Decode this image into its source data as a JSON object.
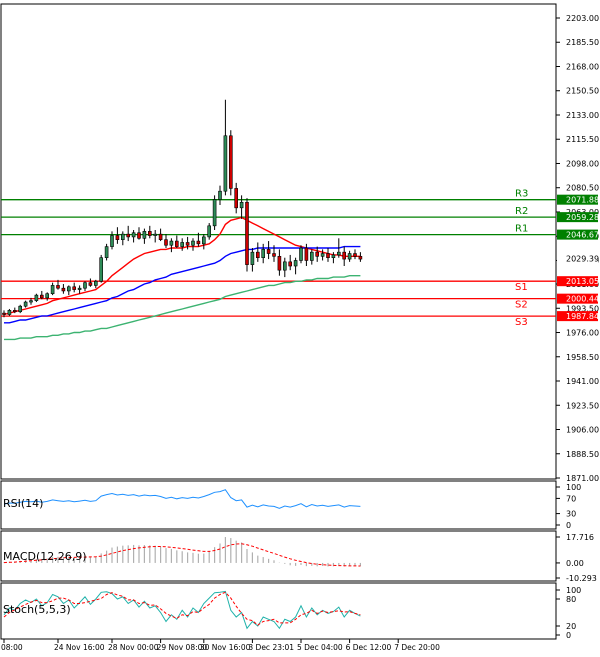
{
  "chart_data": {
    "type": "candlestick",
    "instrument_note": "",
    "price_axis": {
      "ticks": [
        "2203.00",
        "2185.50",
        "2168.00",
        "2150.50",
        "2133.00",
        "2115.50",
        "2098.00",
        "2080.50",
        "2063.00",
        "2045.50",
        "2028.00",
        "2011.00",
        "1993.50",
        "1976.00",
        "1958.50",
        "1941.00",
        "1923.50",
        "1906.00",
        "1888.50",
        "1871.00"
      ],
      "ylim": [
        1871.0,
        2203.0
      ],
      "current_price": "2029.39",
      "current_value": 2029.39
    },
    "time_axis": {
      "ticks": [
        "08:00",
        "24 Nov 16:00",
        "28 Nov 00:00",
        "29 Nov 08:00",
        "30 Nov 16:00",
        "3 Dec 23:01",
        "5 Dec 04:00",
        "6 Dec 12:00",
        "7 Dec 20:00"
      ],
      "tick_index": [
        0,
        10,
        20,
        29,
        37,
        46,
        55,
        64,
        73
      ]
    },
    "levels": [
      {
        "name": "R3",
        "label": "2071.88",
        "value": 2071.88,
        "color": "#008000"
      },
      {
        "name": "R2",
        "label": "2059.28",
        "value": 2059.28,
        "color": "#008000"
      },
      {
        "name": "R1",
        "label": "2046.67",
        "value": 2046.67,
        "color": "#008000"
      },
      {
        "name": "S1",
        "label": "2013.05",
        "value": 2013.05,
        "color": "#ff0000"
      },
      {
        "name": "S2",
        "label": "2000.44",
        "value": 2000.44,
        "color": "#ff0000"
      },
      {
        "name": "S3",
        "label": "1987.84",
        "value": 1987.84,
        "color": "#ff0000"
      }
    ],
    "candles": [
      [
        1990,
        1992,
        1987,
        1989
      ],
      [
        1989,
        1993,
        1988,
        1992
      ],
      [
        1992,
        1994,
        1990,
        1991
      ],
      [
        1991,
        1996,
        1990,
        1995
      ],
      [
        1995,
        1999,
        1994,
        1998
      ],
      [
        1998,
        2001,
        1996,
        1999
      ],
      [
        1999,
        2004,
        1998,
        2003
      ],
      [
        2003,
        2006,
        2000,
        2001
      ],
      [
        2001,
        2005,
        1999,
        2004
      ],
      [
        2004,
        2012,
        2003,
        2010
      ],
      [
        2010,
        2014,
        2007,
        2008
      ],
      [
        2008,
        2011,
        2004,
        2006
      ],
      [
        2006,
        2010,
        2003,
        2009
      ],
      [
        2009,
        2012,
        2005,
        2007
      ],
      [
        2007,
        2010,
        2004,
        2008
      ],
      [
        2008,
        2013,
        2006,
        2012
      ],
      [
        2012,
        2015,
        2009,
        2010
      ],
      [
        2010,
        2014,
        2008,
        2013
      ],
      [
        2013,
        2032,
        2012,
        2030
      ],
      [
        2030,
        2040,
        2028,
        2038
      ],
      [
        2038,
        2049,
        2036,
        2046
      ],
      [
        2046,
        2052,
        2040,
        2043
      ],
      [
        2043,
        2049,
        2039,
        2047
      ],
      [
        2047,
        2053,
        2042,
        2045
      ],
      [
        2045,
        2050,
        2041,
        2048
      ],
      [
        2048,
        2052,
        2043,
        2044
      ],
      [
        2044,
        2051,
        2040,
        2049
      ],
      [
        2049,
        2053,
        2044,
        2046
      ],
      [
        2046,
        2050,
        2041,
        2047
      ],
      [
        2047,
        2051,
        2042,
        2043
      ],
      [
        2043,
        2047,
        2037,
        2039
      ],
      [
        2039,
        2044,
        2034,
        2042
      ],
      [
        2042,
        2046,
        2037,
        2038
      ],
      [
        2038,
        2044,
        2035,
        2041
      ],
      [
        2041,
        2045,
        2036,
        2039
      ],
      [
        2039,
        2044,
        2035,
        2042
      ],
      [
        2042,
        2048,
        2038,
        2040
      ],
      [
        2040,
        2047,
        2036,
        2045
      ],
      [
        2045,
        2055,
        2043,
        2053
      ],
      [
        2053,
        2075,
        2050,
        2072
      ],
      [
        2072,
        2082,
        2068,
        2078
      ],
      [
        2078,
        2144,
        2075,
        2118
      ],
      [
        2118,
        2122,
        2075,
        2080
      ],
      [
        2080,
        2084,
        2062,
        2066
      ],
      [
        2066,
        2075,
        2058,
        2070
      ],
      [
        2070,
        2073,
        2020,
        2025
      ],
      [
        2025,
        2037,
        2020,
        2034
      ],
      [
        2034,
        2041,
        2027,
        2030
      ],
      [
        2030,
        2040,
        2026,
        2036
      ],
      [
        2036,
        2042,
        2029,
        2033
      ],
      [
        2033,
        2039,
        2027,
        2031
      ],
      [
        2031,
        2036,
        2017,
        2021
      ],
      [
        2021,
        2030,
        2016,
        2027
      ],
      [
        2027,
        2032,
        2021,
        2024
      ],
      [
        2024,
        2030,
        2018,
        2028
      ],
      [
        2028,
        2039,
        2026,
        2037
      ],
      [
        2037,
        2040,
        2024,
        2028
      ],
      [
        2028,
        2036,
        2025,
        2034
      ],
      [
        2034,
        2038,
        2027,
        2031
      ],
      [
        2031,
        2036,
        2028,
        2033
      ],
      [
        2033,
        2037,
        2027,
        2030
      ],
      [
        2030,
        2034,
        2026,
        2032
      ],
      [
        2032,
        2044,
        2030,
        2034
      ],
      [
        2034,
        2038,
        2024,
        2029
      ],
      [
        2029,
        2035,
        2027,
        2033
      ],
      [
        2033,
        2036,
        2029,
        2031
      ],
      [
        2031,
        2034,
        2027,
        2029
      ]
    ],
    "moving_averages": [
      {
        "color": "#ff0000",
        "values": [
          1989,
          1990,
          1991,
          1992,
          1993,
          1994,
          1995,
          1996,
          1997,
          1999,
          2000,
          2001,
          2002,
          2003,
          2004,
          2005,
          2006,
          2007,
          2010,
          2013,
          2017,
          2020,
          2023,
          2026,
          2029,
          2031,
          2033,
          2034,
          2035,
          2036,
          2036,
          2037,
          2037,
          2037,
          2038,
          2038,
          2038,
          2039,
          2040,
          2043,
          2047,
          2054,
          2057,
          2058,
          2059,
          2057,
          2055,
          2053,
          2051,
          2049,
          2047,
          2045,
          2043,
          2041,
          2039,
          2038,
          2037,
          2036,
          2035,
          2034,
          2033,
          2032,
          2032,
          2031,
          2031,
          2031,
          2031
        ]
      },
      {
        "color": "#0000ff",
        "values": [
          1983,
          1983,
          1984,
          1985,
          1985,
          1986,
          1987,
          1988,
          1988,
          1989,
          1990,
          1991,
          1992,
          1993,
          1994,
          1995,
          1996,
          1997,
          1998,
          1999,
          2001,
          2002,
          2004,
          2006,
          2007,
          2009,
          2011,
          2012,
          2014,
          2015,
          2016,
          2018,
          2019,
          2020,
          2021,
          2022,
          2023,
          2024,
          2025,
          2026,
          2028,
          2031,
          2033,
          2034,
          2035,
          2036,
          2036,
          2037,
          2037,
          2037,
          2037,
          2037,
          2037,
          2037,
          2037,
          2037,
          2037,
          2037,
          2037,
          2037,
          2037,
          2037,
          2037,
          2038,
          2038,
          2038,
          2038
        ]
      },
      {
        "color": "#3cb371",
        "values": [
          1971,
          1971,
          1971,
          1972,
          1972,
          1972,
          1973,
          1973,
          1973,
          1974,
          1974,
          1975,
          1975,
          1976,
          1976,
          1977,
          1977,
          1978,
          1979,
          1979,
          1980,
          1981,
          1982,
          1983,
          1984,
          1985,
          1986,
          1987,
          1988,
          1989,
          1990,
          1991,
          1992,
          1993,
          1994,
          1995,
          1996,
          1997,
          1998,
          1999,
          2000,
          2002,
          2003,
          2004,
          2005,
          2006,
          2007,
          2008,
          2009,
          2010,
          2010,
          2011,
          2012,
          2012,
          2013,
          2013,
          2014,
          2014,
          2015,
          2015,
          2015,
          2016,
          2016,
          2016,
          2017,
          2017,
          2017
        ]
      }
    ],
    "rsi": {
      "label": "RSI(14)",
      "ticks": [
        "100",
        "70",
        "30",
        "0"
      ],
      "levels": [
        100,
        70,
        30,
        0
      ],
      "values": [
        55,
        58,
        57,
        60,
        62,
        61,
        63,
        60,
        62,
        66,
        64,
        62,
        64,
        61,
        63,
        65,
        62,
        64,
        76,
        80,
        83,
        79,
        81,
        78,
        80,
        76,
        79,
        77,
        78,
        75,
        70,
        73,
        69,
        72,
        70,
        73,
        71,
        75,
        80,
        86,
        88,
        93,
        72,
        64,
        66,
        47,
        52,
        48,
        53,
        50,
        49,
        44,
        50,
        47,
        51,
        56,
        48,
        54,
        50,
        52,
        49,
        51,
        53,
        47,
        51,
        50,
        49
      ]
    },
    "macd": {
      "label": "MACD(12,26,9)",
      "ticks": [
        "17.716",
        "0.00",
        "-10.293"
      ],
      "ylim": [
        -10.293,
        17.716
      ],
      "histogram": [
        0.5,
        0.8,
        1.0,
        1.4,
        1.9,
        2.2,
        2.6,
        2.7,
        3.0,
        4.0,
        4.2,
        4.1,
        4.2,
        4.0,
        4.0,
        4.3,
        4.1,
        4.3,
        6.5,
        8.4,
        10.5,
        11.2,
        11.8,
        12.0,
        12.3,
        12.0,
        12.2,
        12.0,
        11.8,
        11.2,
        10.1,
        9.6,
        8.6,
        8.0,
        7.2,
        6.9,
        6.3,
        6.4,
        7.9,
        10.8,
        13.3,
        17.7,
        17.0,
        15.2,
        14.0,
        9.5,
        7.2,
        5.0,
        4.0,
        2.8,
        1.8,
        0.2,
        -0.6,
        -1.6,
        -2.0,
        -1.4,
        -2.2,
        -2.0,
        -2.3,
        -2.1,
        -2.4,
        -2.3,
        -1.8,
        -2.4,
        -2.1,
        -2.2,
        -2.3
      ],
      "signal": [
        0.2,
        0.4,
        0.6,
        0.9,
        1.2,
        1.5,
        1.8,
        2.1,
        2.4,
        2.8,
        3.2,
        3.5,
        3.7,
        3.8,
        3.9,
        4.0,
        4.1,
        4.2,
        4.7,
        5.5,
        6.5,
        7.5,
        8.4,
        9.1,
        9.8,
        10.3,
        10.7,
        11.0,
        11.2,
        11.2,
        11.0,
        10.7,
        10.3,
        9.8,
        9.3,
        8.8,
        8.3,
        7.9,
        7.9,
        8.5,
        9.5,
        11.1,
        12.3,
        12.9,
        13.1,
        12.4,
        11.4,
        10.1,
        8.9,
        7.7,
        6.5,
        5.2,
        4.0,
        2.8,
        1.8,
        1.0,
        0.2,
        -0.4,
        -0.9,
        -1.2,
        -1.5,
        -1.7,
        -1.8,
        -1.9,
        -2.0,
        -2.0,
        -2.1
      ]
    },
    "stoch": {
      "label": "Stoch(5,5,3)",
      "ticks": [
        "100",
        "80",
        "20",
        "0"
      ],
      "levels": [
        100,
        80,
        20,
        0
      ],
      "main": [
        45,
        60,
        55,
        70,
        78,
        72,
        80,
        65,
        72,
        90,
        85,
        70,
        78,
        60,
        72,
        85,
        68,
        80,
        95,
        96,
        92,
        80,
        85,
        70,
        78,
        62,
        75,
        60,
        65,
        50,
        30,
        45,
        35,
        55,
        40,
        60,
        50,
        70,
        82,
        94,
        95,
        97,
        55,
        40,
        50,
        15,
        30,
        20,
        40,
        35,
        30,
        15,
        35,
        30,
        40,
        65,
        40,
        60,
        45,
        55,
        48,
        52,
        62,
        40,
        55,
        48,
        42
      ],
      "signal": [
        40,
        50,
        56,
        62,
        68,
        73,
        77,
        72,
        72,
        76,
        82,
        82,
        78,
        70,
        70,
        72,
        75,
        78,
        81,
        90,
        94,
        89,
        86,
        78,
        78,
        70,
        72,
        66,
        67,
        58,
        48,
        42,
        37,
        45,
        43,
        52,
        50,
        60,
        68,
        82,
        90,
        95,
        82,
        64,
        48,
        35,
        32,
        22,
        30,
        32,
        35,
        27,
        27,
        27,
        35,
        45,
        48,
        55,
        48,
        53,
        50,
        52,
        54,
        51,
        52,
        48,
        45
      ]
    }
  }
}
